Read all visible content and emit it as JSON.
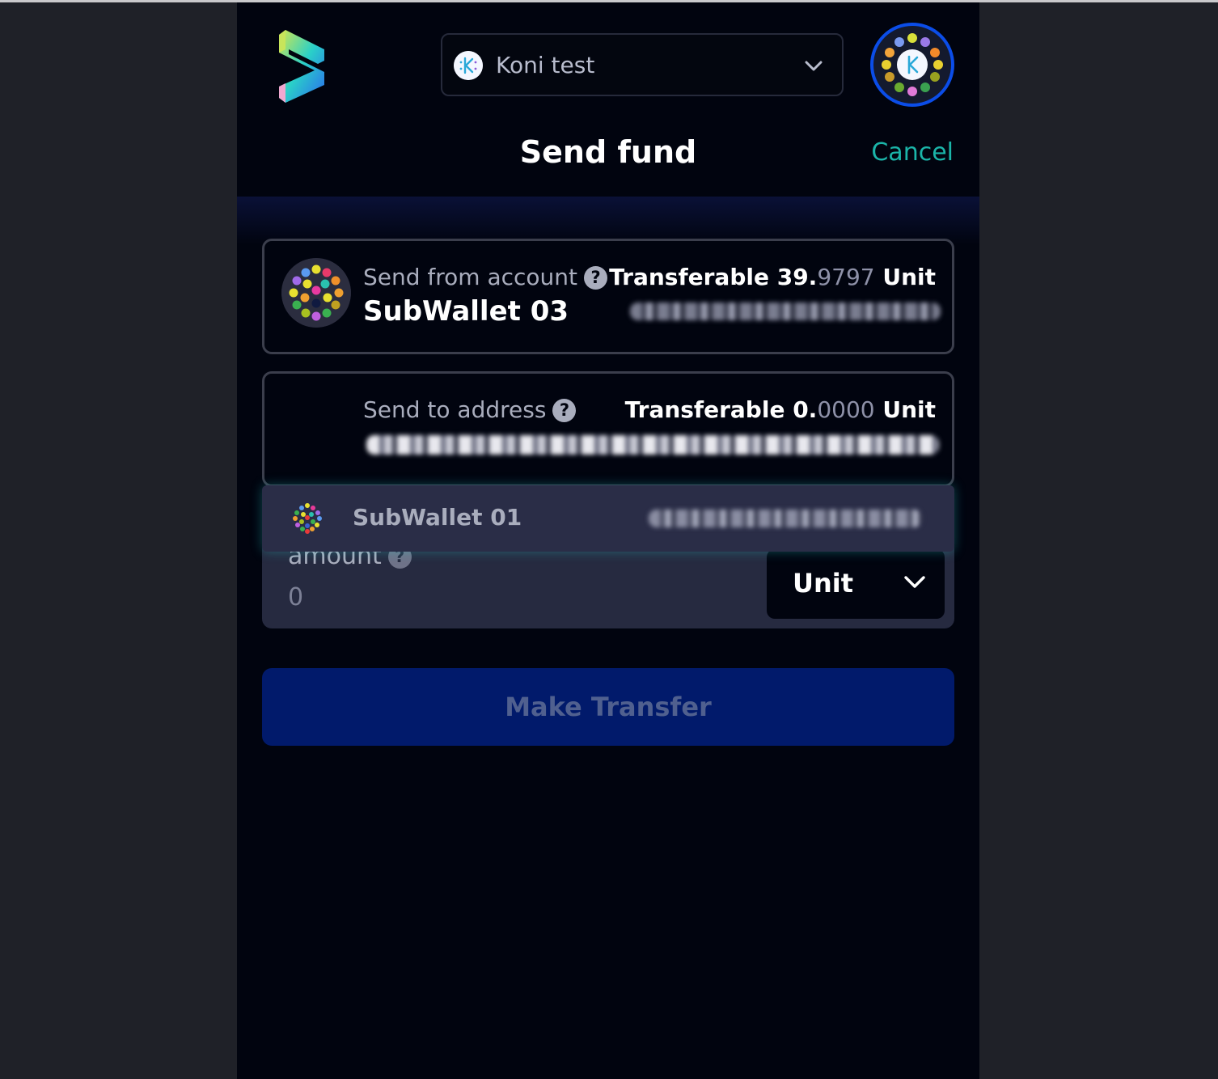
{
  "header": {
    "network_label": "Koni test",
    "title": "Send fund",
    "cancel_label": "Cancel"
  },
  "send_from": {
    "label": "Send from account",
    "account_name": "SubWallet 03",
    "transferable_label": "Transferable",
    "balance_int": "39.",
    "balance_dec": "9797",
    "unit": "Unit"
  },
  "send_to": {
    "label": "Send to address",
    "transferable_label": "Transferable",
    "balance_int": "0.",
    "balance_dec": "0000",
    "unit": "Unit"
  },
  "suggestion": {
    "account_name": "SubWallet 01"
  },
  "amount": {
    "label": "amount",
    "value": "0",
    "token": "Unit"
  },
  "actions": {
    "transfer_label": "Make Transfer"
  },
  "colors": {
    "accent_teal": "#1bb5a9",
    "primary_blue": "#011a6b",
    "avatar_ring": "#0b4de8"
  },
  "icons": [
    "subwallet-logo-icon",
    "network-icon",
    "chevron-down-icon",
    "help-icon",
    "identicon-avatar-icon"
  ]
}
